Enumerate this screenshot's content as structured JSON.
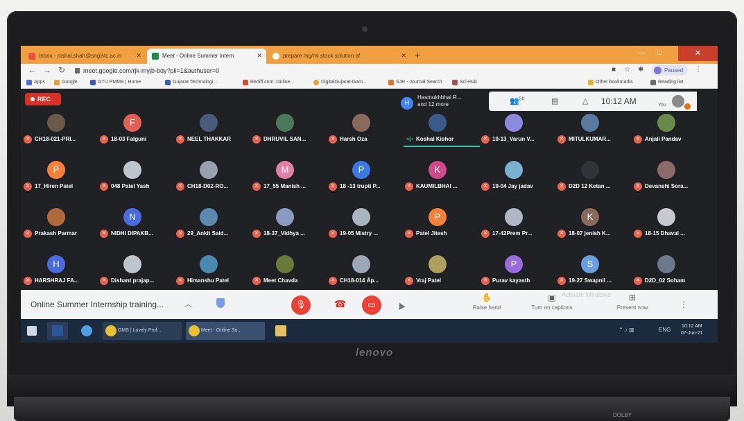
{
  "browser": {
    "tabs": [
      {
        "label": "Inbox - nishal.shah@sngistc.ac.in",
        "icon": "gmail-icon"
      },
      {
        "label": "Meet - Online Summer Intern",
        "icon": "meet-icon"
      },
      {
        "label": "prepare mg/ml stock solution of",
        "icon": "google-icon"
      }
    ],
    "new_tab": "+",
    "url": "meet.google.com/rjk-myjb-bdy?pli=1&authuser=0",
    "profile_label": "Paused",
    "bookmarks": [
      {
        "label": "Apps"
      },
      {
        "label": "Google"
      },
      {
        "label": "GTU PMMS | Home"
      },
      {
        "label": "Gujarat Technologi..."
      },
      {
        "label": "Rediff.com: Online..."
      },
      {
        "label": "DigitalGujarat-Gam..."
      },
      {
        "label": "SJR - Journal Search"
      },
      {
        "label": "Sci-Hub"
      }
    ],
    "other_bookmarks": "Other bookmarks",
    "reading_list": "Reading list"
  },
  "meet": {
    "rec_label": "REC",
    "presenter_initial": "H",
    "presenter_name": "Hasmukhbhai R...",
    "presenter_more": "and 12 more",
    "people_count": "50",
    "clock": "10:12 AM",
    "you_label": "You",
    "participants": [
      {
        "name": "CH18-021-PRI...",
        "initial": "",
        "color": "#6b5a48"
      },
      {
        "name": "18-03 Falguni",
        "initial": "F",
        "color": "#e06055"
      },
      {
        "name": "NEEL THAKKAR",
        "initial": "",
        "color": "#4a5a7a"
      },
      {
        "name": "DHRUVIL SAN...",
        "initial": "",
        "color": "#4a7a5a"
      },
      {
        "name": "Harsh Oza",
        "initial": "",
        "color": "#8a6a5a"
      },
      {
        "name": "Koshal Kishor",
        "initial": "",
        "color": "#3a5a8a",
        "speaking": true
      },
      {
        "name": "19-13_Varun V...",
        "initial": "",
        "color": "#8a8ae0"
      },
      {
        "name": "MITULKUMAR...",
        "initial": "",
        "color": "#5a7aa0"
      },
      {
        "name": "Anjali Pandav",
        "initial": "",
        "color": "#6a8a4a"
      },
      {
        "name": "17_Hiren Patel",
        "initial": "P",
        "color": "#f4803a"
      },
      {
        "name": "048 Patel Yash",
        "initial": "",
        "color": "#c0c4cc"
      },
      {
        "name": "CH18-D02-RO...",
        "initial": "",
        "color": "#9aa0b0"
      },
      {
        "name": "17_55 Manish ...",
        "initial": "M",
        "color": "#e080a8"
      },
      {
        "name": "18 -13 trupti P...",
        "initial": "P",
        "color": "#3a7ae0"
      },
      {
        "name": "KAUMILBHAI ...",
        "initial": "K",
        "color": "#d04a8a"
      },
      {
        "name": "19-04 Jay jadav",
        "initial": "",
        "color": "#7ab0d0"
      },
      {
        "name": "D2D 12 Ketan ...",
        "initial": "",
        "color": "#303438"
      },
      {
        "name": "Devanshi Sora...",
        "initial": "",
        "color": "#8a6a6a"
      },
      {
        "name": "Prakash Parmar",
        "initial": "",
        "color": "#b06a3a"
      },
      {
        "name": "NIDHI DIPAKB...",
        "initial": "N",
        "color": "#4a6ae0"
      },
      {
        "name": "29_Ankit Said...",
        "initial": "",
        "color": "#5a8ab0"
      },
      {
        "name": "18-37_Vidhya ...",
        "initial": "",
        "color": "#8a9ac0"
      },
      {
        "name": "19-05 Mistry ...",
        "initial": "",
        "color": "#aab4c0"
      },
      {
        "name": "Patel Jitesh",
        "initial": "P",
        "color": "#f4803a"
      },
      {
        "name": "17-42Prem Pr...",
        "initial": "",
        "color": "#b0b8c8"
      },
      {
        "name": "18-07 jenish K...",
        "initial": "K",
        "color": "#8a6a5a"
      },
      {
        "name": "18-15 Dhaval ...",
        "initial": "",
        "color": "#c8c8d0"
      },
      {
        "name": "HARSHRAJ FA...",
        "initial": "H",
        "color": "#4a6ae0"
      },
      {
        "name": "Dishant prajap...",
        "initial": "",
        "color": "#c0c4cc"
      },
      {
        "name": "Himanshu Patel",
        "initial": "",
        "color": "#4a8ab0"
      },
      {
        "name": "Meet Chavda",
        "initial": "",
        "color": "#6a7a3a"
      },
      {
        "name": "CH18-014 Āp...",
        "initial": "",
        "color": "#9aa8b8"
      },
      {
        "name": "Vraj Patel",
        "initial": "",
        "color": "#b0a060"
      },
      {
        "name": "Purav kayasth",
        "initial": "P",
        "color": "#9a6ae0"
      },
      {
        "name": "19-27 Swapnil ...",
        "initial": "S",
        "color": "#6aa0e0"
      },
      {
        "name": "D2D_02 Soham",
        "initial": "",
        "color": "#6a7a8a"
      }
    ],
    "meeting_title": "Online Summer Internship training...",
    "raise_hand": "Raise hand",
    "captions": "Turn on captions",
    "present": "Present now",
    "watermark": "Activate Windows"
  },
  "taskbar": {
    "items": [
      {
        "label": "",
        "icon": "word-icon"
      },
      {
        "label": "",
        "icon": "ie-icon"
      },
      {
        "label": "GMS | Lovely Prof...",
        "icon": "chrome-icon"
      },
      {
        "label": "Meet - Online Su...",
        "icon": "chrome-icon"
      },
      {
        "label": "",
        "icon": "folder-icon"
      }
    ],
    "lang": "ENG",
    "time": "10:12 AM",
    "date": "07-Jun-21"
  },
  "laptop_brand": "lenovo",
  "sticker": "DOLBY"
}
